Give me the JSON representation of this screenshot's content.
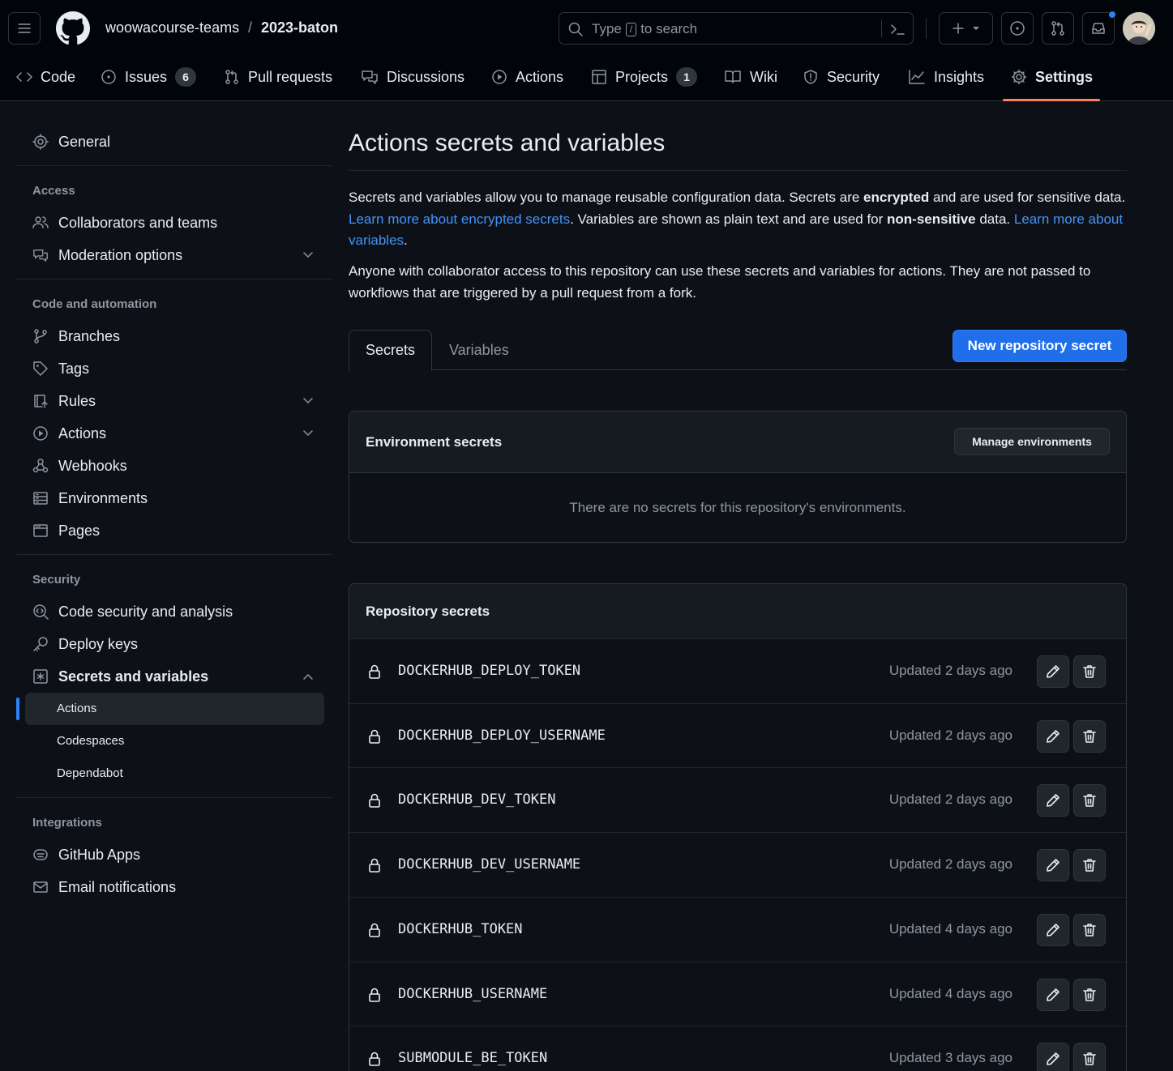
{
  "header": {
    "owner": "woowacourse-teams",
    "separator": "/",
    "repo": "2023-baton",
    "search_prefix": "Type",
    "search_key": "/",
    "search_suffix": "to search"
  },
  "nav": {
    "code": "Code",
    "issues": "Issues",
    "issues_count": "6",
    "pull_requests": "Pull requests",
    "discussions": "Discussions",
    "actions": "Actions",
    "projects": "Projects",
    "projects_count": "1",
    "wiki": "Wiki",
    "security": "Security",
    "insights": "Insights",
    "settings": "Settings"
  },
  "sidebar": {
    "general": "General",
    "access_heading": "Access",
    "collaborators": "Collaborators and teams",
    "moderation": "Moderation options",
    "code_heading": "Code and automation",
    "branches": "Branches",
    "tags": "Tags",
    "rules": "Rules",
    "actions": "Actions",
    "webhooks": "Webhooks",
    "environments": "Environments",
    "pages": "Pages",
    "security_heading": "Security",
    "code_security": "Code security and analysis",
    "deploy_keys": "Deploy keys",
    "secrets_vars": "Secrets and variables",
    "sub_actions": "Actions",
    "sub_codespaces": "Codespaces",
    "sub_dependabot": "Dependabot",
    "integrations_heading": "Integrations",
    "github_apps": "GitHub Apps",
    "email_notifications": "Email notifications"
  },
  "main": {
    "title": "Actions secrets and variables",
    "p1_a": "Secrets and variables allow you to manage reusable configuration data. Secrets are ",
    "p1_b": "encrypted",
    "p1_c": " and are used for sensitive data. ",
    "p1_link1": "Learn more about encrypted secrets",
    "p1_d": ". Variables are shown as plain text and are used for ",
    "p1_e": "non-sensitive",
    "p1_f": " data. ",
    "p1_link2": "Learn more about variables",
    "p1_g": ".",
    "p2": "Anyone with collaborator access to this repository can use these secrets and variables for actions. They are not passed to workflows that are triggered by a pull request from a fork.",
    "tab_secrets": "Secrets",
    "tab_variables": "Variables",
    "new_secret_btn": "New repository secret",
    "env_title": "Environment secrets",
    "manage_env_btn": "Manage environments",
    "env_empty": "There are no secrets for this repository's environments.",
    "repo_title": "Repository secrets"
  },
  "secrets": [
    {
      "name": "DOCKERHUB_DEPLOY_TOKEN",
      "updated": "Updated 2 days ago"
    },
    {
      "name": "DOCKERHUB_DEPLOY_USERNAME",
      "updated": "Updated 2 days ago"
    },
    {
      "name": "DOCKERHUB_DEV_TOKEN",
      "updated": "Updated 2 days ago"
    },
    {
      "name": "DOCKERHUB_DEV_USERNAME",
      "updated": "Updated 2 days ago"
    },
    {
      "name": "DOCKERHUB_TOKEN",
      "updated": "Updated 4 days ago"
    },
    {
      "name": "DOCKERHUB_USERNAME",
      "updated": "Updated 4 days ago"
    },
    {
      "name": "SUBMODULE_BE_TOKEN",
      "updated": "Updated 3 days ago"
    }
  ],
  "colors": {
    "background": "#0d1117",
    "header_bg": "#010409",
    "accent_blue": "#1f6feb",
    "link_blue": "#4493f8",
    "active_underline": "#f78166",
    "muted": "#8d96a0"
  }
}
